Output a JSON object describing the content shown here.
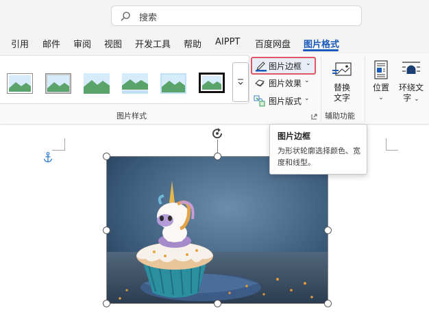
{
  "search": {
    "placeholder": "搜索",
    "icon": "search-icon"
  },
  "tabs": [
    {
      "label": "引用"
    },
    {
      "label": "邮件"
    },
    {
      "label": "审阅"
    },
    {
      "label": "视图"
    },
    {
      "label": "开发工具"
    },
    {
      "label": "帮助"
    },
    {
      "label": "AIPPT"
    },
    {
      "label": "百度网盘"
    },
    {
      "label": "图片格式",
      "active": true
    }
  ],
  "ribbon": {
    "picture_styles_label": "图片样式",
    "gallery_style_count": 6,
    "commands": {
      "border": "图片边框",
      "effects": "图片效果",
      "layout": "图片版式"
    },
    "alt_text": {
      "line1": "替换",
      "line2": "文字"
    },
    "accessibility_label": "辅助功能",
    "position": "位置",
    "wrap_text": {
      "line1": "环绕文",
      "line2": "字"
    }
  },
  "tooltip": {
    "title": "图片边框",
    "body": "为形状轮廓选择颜色、宽度和线型。"
  },
  "colors": {
    "accent": "#185abd",
    "highlight_border": "#e05560",
    "ribbon_bg": "#f9f9f9",
    "titlebar_bg": "#f3f3f3"
  }
}
